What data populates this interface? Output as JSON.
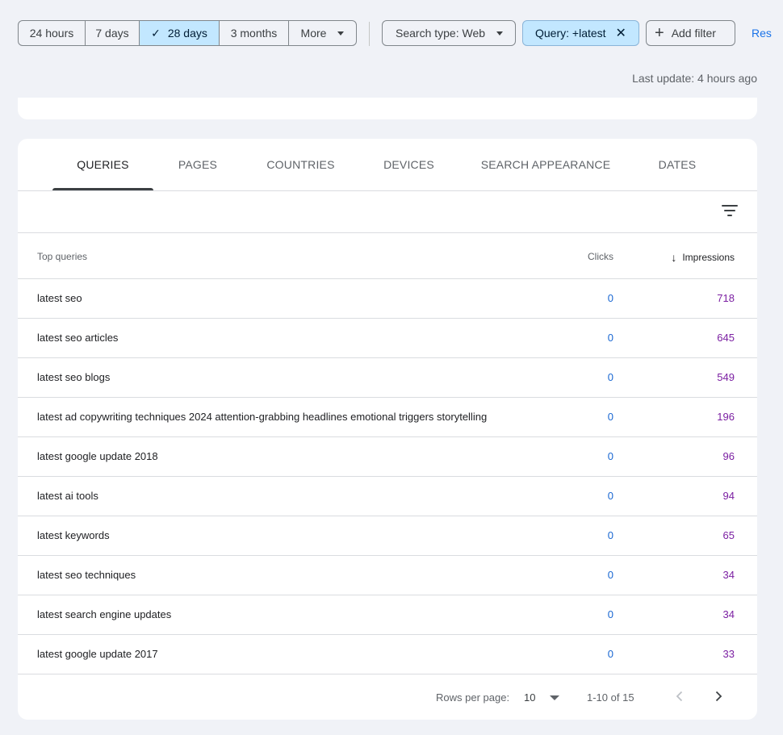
{
  "date_range": {
    "options": [
      "24 hours",
      "7 days",
      "28 days",
      "3 months",
      "More"
    ],
    "selected": "28 days"
  },
  "filters": {
    "search_type": "Search type: Web",
    "query": "Query: +latest",
    "add_filter": "Add filter",
    "reset": "Res"
  },
  "last_update": "Last update: 4 hours ago",
  "tabs": [
    "QUERIES",
    "PAGES",
    "COUNTRIES",
    "DEVICES",
    "SEARCH APPEARANCE",
    "DATES"
  ],
  "active_tab": "QUERIES",
  "table": {
    "headers": {
      "query": "Top queries",
      "clicks": "Clicks",
      "impressions": "Impressions"
    },
    "sort": "impressions-desc",
    "rows": [
      {
        "query": "latest seo",
        "clicks": "0",
        "impressions": "718"
      },
      {
        "query": "latest seo articles",
        "clicks": "0",
        "impressions": "645"
      },
      {
        "query": "latest seo blogs",
        "clicks": "0",
        "impressions": "549"
      },
      {
        "query": "latest ad copywriting techniques 2024 attention-grabbing headlines emotional triggers storytelling",
        "clicks": "0",
        "impressions": "196"
      },
      {
        "query": "latest google update 2018",
        "clicks": "0",
        "impressions": "96"
      },
      {
        "query": "latest ai tools",
        "clicks": "0",
        "impressions": "94"
      },
      {
        "query": "latest keywords",
        "clicks": "0",
        "impressions": "65"
      },
      {
        "query": "latest seo techniques",
        "clicks": "0",
        "impressions": "34"
      },
      {
        "query": "latest search engine updates",
        "clicks": "0",
        "impressions": "34"
      },
      {
        "query": "latest google update 2017",
        "clicks": "0",
        "impressions": "33"
      }
    ]
  },
  "pagination": {
    "rows_per_page_label": "Rows per page:",
    "rows_per_page": "10",
    "range": "1-10 of 15"
  },
  "colors": {
    "background": "#f0f2f7",
    "selected_chip": "#c2e7ff",
    "clicks": "#1967d2",
    "impressions": "#7b1fa2",
    "link": "#1a73e8"
  },
  "icons": {
    "check": "check-icon",
    "close": "close-icon",
    "plus": "plus-icon",
    "filter": "filter-list-icon",
    "sort": "arrow-down-icon",
    "prev": "chevron-left-icon",
    "next": "chevron-right-icon"
  }
}
